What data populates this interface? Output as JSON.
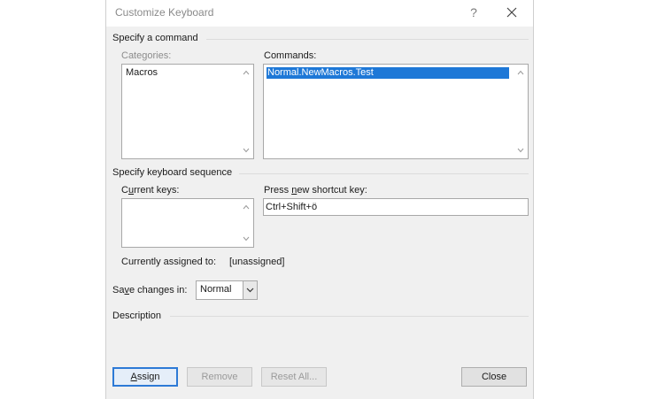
{
  "window": {
    "title": "Customize Keyboard",
    "help_glyph": "?",
    "close_icon": "close-icon"
  },
  "command_section": {
    "title": "Specify a command",
    "categories": {
      "label": "Categories:",
      "items": [
        "Macros"
      ]
    },
    "commands": {
      "label": "Commands:",
      "items": [
        "Normal.NewMacros.Test"
      ],
      "selected_index": 0
    }
  },
  "keyboard_section": {
    "title": "Specify keyboard sequence",
    "current_keys": {
      "label": "Current keys:",
      "items": []
    },
    "new_shortcut": {
      "label": "Press new shortcut key:",
      "value": "Ctrl+Shift+ö"
    },
    "assigned": {
      "label": "Currently assigned to:",
      "value": "[unassigned]"
    }
  },
  "save_changes": {
    "label": "Save changes in:",
    "selected": "Normal"
  },
  "description": {
    "title": "Description"
  },
  "buttons": {
    "assign": "Assign",
    "remove": "Remove",
    "reset_all": "Reset All...",
    "close": "Close"
  },
  "colors": {
    "selection": "#1e78d7",
    "dialog_bg": "#f0f0f0",
    "default_button_border": "#2d7ad6"
  }
}
